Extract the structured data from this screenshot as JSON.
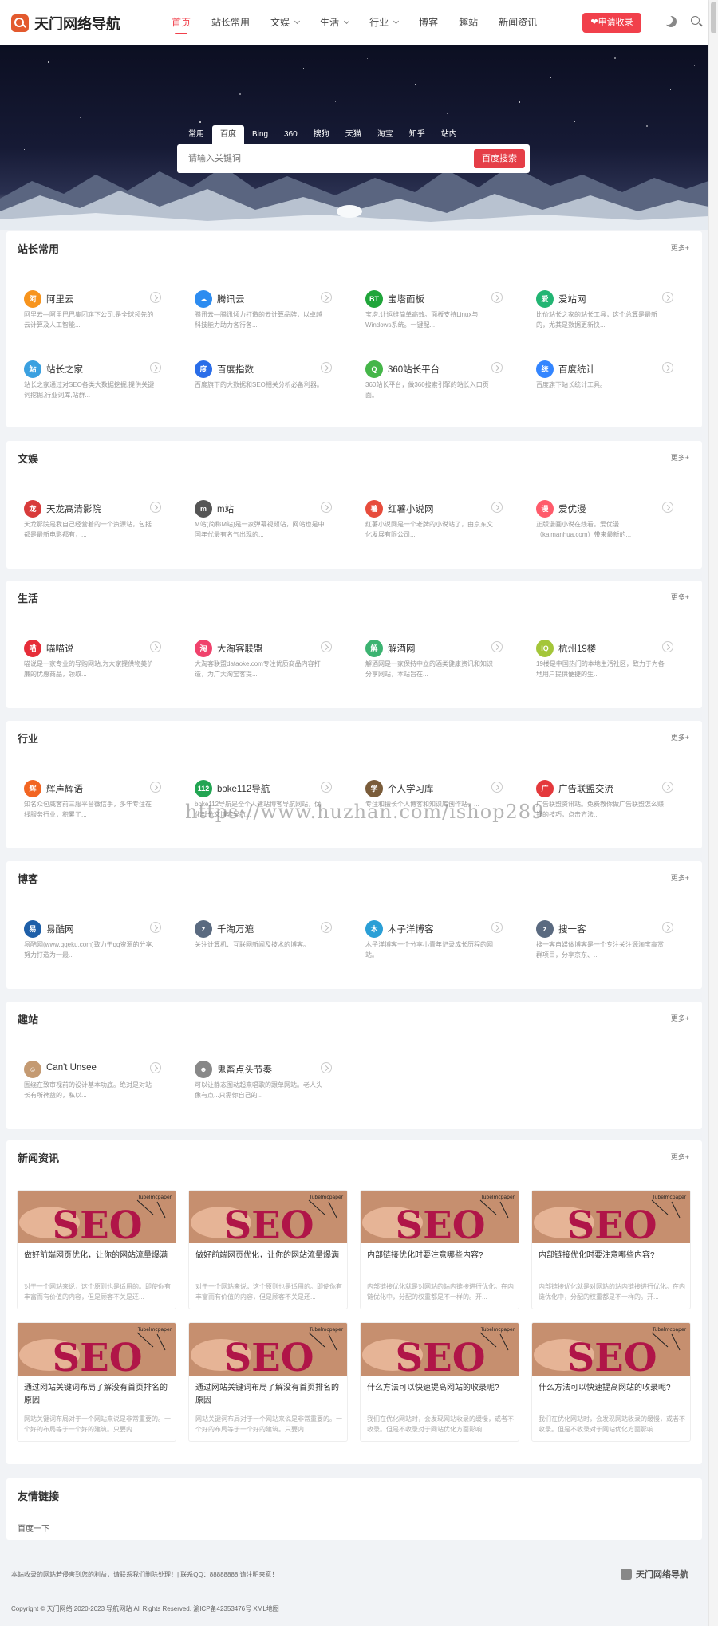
{
  "header": {
    "logo_text": "天门网络导航",
    "nav": [
      {
        "label": "首页",
        "active": true,
        "dropdown": false
      },
      {
        "label": "站长常用",
        "active": false,
        "dropdown": false
      },
      {
        "label": "文娱",
        "active": false,
        "dropdown": true
      },
      {
        "label": "生活",
        "active": false,
        "dropdown": true
      },
      {
        "label": "行业",
        "active": false,
        "dropdown": true
      },
      {
        "label": "博客",
        "active": false,
        "dropdown": false
      },
      {
        "label": "趣站",
        "active": false,
        "dropdown": false
      },
      {
        "label": "新闻资讯",
        "active": false,
        "dropdown": false
      }
    ],
    "apply_button": "❤申请收录",
    "icons": [
      "moon-icon",
      "search-icon"
    ]
  },
  "search": {
    "tabs": [
      "常用",
      "百度",
      "Bing",
      "360",
      "搜狗",
      "天猫",
      "淘宝",
      "知乎",
      "站内"
    ],
    "active_tab": "百度",
    "placeholder": "请输入关键词",
    "button": "百度搜索"
  },
  "more_label": "更多+",
  "sections": [
    {
      "title": "站长常用",
      "sites": [
        {
          "name": "阿里云",
          "desc": "阿里云—阿里巴巴集团旗下公司,是全球领先的云计算及人工智能...",
          "icon_color": "#f7941d",
          "icon_glyph": "阿"
        },
        {
          "name": "腾讯云",
          "desc": "腾讯云—腾讯倾力打造的云计算品牌，以卓越科技能力助力各行各...",
          "icon_color": "#2d8cf0",
          "icon_glyph": "☁"
        },
        {
          "name": "宝塔面板",
          "desc": "宝塔,让运维简单高效。面板支持Linux与Windows系统。一键配...",
          "icon_color": "#20a53a",
          "icon_glyph": "BT"
        },
        {
          "name": "爱站网",
          "desc": "比价站长之家的站长工具，这个总算是最新的，尤其是数据更新快...",
          "icon_color": "#22b573",
          "icon_glyph": "爱"
        },
        {
          "name": "站长之家",
          "desc": "站长之家通过对SEO各类大数据挖掘,提供关键词挖掘,行业词库,站群...",
          "icon_color": "#3aa0e0",
          "icon_glyph": "站"
        },
        {
          "name": "百度指数",
          "desc": "百度旗下的大数据和SEO相关分析必备利器。",
          "icon_color": "#2a6de8",
          "icon_glyph": "度"
        },
        {
          "name": "360站长平台",
          "desc": "360站长平台，做360搜索引擎的站长入口页面。",
          "icon_color": "#45b649",
          "icon_glyph": "Q"
        },
        {
          "name": "百度统计",
          "desc": "百度旗下站长统计工具。",
          "icon_color": "#3385ff",
          "icon_glyph": "统"
        }
      ]
    },
    {
      "title": "文娱",
      "sites": [
        {
          "name": "天龙高清影院",
          "desc": "天龙影院是我自己经营着的一个资源站，包括都是最新电影都有，...",
          "icon_color": "#d83b3b",
          "icon_glyph": "龙"
        },
        {
          "name": "m站",
          "desc": "M站(简称M站)是一家弹幕视频站，网站也是中国年代最有名气出现的...",
          "icon_color": "#555555",
          "icon_glyph": "m"
        },
        {
          "name": "红薯小说网",
          "desc": "红薯小说网是一个老牌的小说站了，由京东文化发展有限公司...",
          "icon_color": "#e74c3c",
          "icon_glyph": "薯"
        },
        {
          "name": "爱优漫",
          "desc": "正版漫画小说在线看。爱优漫（kaimanhua.com）带来最新的...",
          "icon_color": "#ff5b6b",
          "icon_glyph": "漫"
        }
      ]
    },
    {
      "title": "生活",
      "sites": [
        {
          "name": "喵喵说",
          "desc": "喵说是一家专业的导购网站,为大家提供物美价廉的优惠商品，领取...",
          "icon_color": "#e62d39",
          "icon_glyph": "喵"
        },
        {
          "name": "大淘客联盟",
          "desc": "大淘客联盟dataoke.com专注优质商品内容打造，为广大淘宝客提...",
          "icon_color": "#f0426c",
          "icon_glyph": "淘"
        },
        {
          "name": "解酒网",
          "desc": "解酒网是一家保持中立的酒类健康资讯和知识分享网站，本站旨在...",
          "icon_color": "#3cb371",
          "icon_glyph": "解"
        },
        {
          "name": "杭州19楼",
          "desc": "19楼是中国热门的本地生活社区，致力于为各地用户提供便捷的生...",
          "icon_color": "#a4c639",
          "icon_glyph": "IQ"
        }
      ]
    },
    {
      "title": "行业",
      "sites": [
        {
          "name": "辉声辉语",
          "desc": "知名众包威客前三服平台微信手，多年专注在线服务行业，积累了...",
          "icon_color": "#f26522",
          "icon_glyph": "辉"
        },
        {
          "name": "boke112导航",
          "desc": "boke112导航是全个人建站博客导航网站，优化部分文博客导航...",
          "icon_color": "#22a552",
          "icon_glyph": "112"
        },
        {
          "name": "个人学习库",
          "desc": "专注和擅长个人博客和知识库创作站，...",
          "icon_color": "#7a5c3a",
          "icon_glyph": "学"
        },
        {
          "name": "广告联盟交流",
          "desc": "广告联盟资讯站。免费教你做广告联盟怎么赚钱的技巧，点击方法...",
          "icon_color": "#e4393c",
          "icon_glyph": "广"
        }
      ]
    },
    {
      "title": "博客",
      "sites": [
        {
          "name": "易酷网",
          "desc": "易酷网(www.qqeku.com)致力于qq资源的分享,努力打造为一最...",
          "icon_color": "#1e5fa8",
          "icon_glyph": "易"
        },
        {
          "name": "千淘万漉",
          "desc": "关注计算机、互联网新闻及技术的博客。",
          "icon_color": "#5a6a80",
          "icon_glyph": "z"
        },
        {
          "name": "木子洋博客",
          "desc": "木子洋博客一个分享小青年记录成长历程的网站。",
          "icon_color": "#2a9fd6",
          "icon_glyph": "木"
        },
        {
          "name": "搜一客",
          "desc": "搜一客自媒体博客是一个专注关注源淘宝高赏群项目，分享京东、...",
          "icon_color": "#5a6a80",
          "icon_glyph": "z"
        }
      ]
    },
    {
      "title": "趣站",
      "sites": [
        {
          "name": "Can't Unsee",
          "desc": "围绕在致审视前的设计基本功底。绝对是对站长有所裨益的，私以...",
          "icon_color": "#c49a72",
          "icon_glyph": "☺"
        },
        {
          "name": "鬼畜点头节奏",
          "desc": "可以让静态图动起来唱歌的跟单网站。老人头像有点...只需你自己的...",
          "icon_color": "#888888",
          "icon_glyph": "☻"
        }
      ]
    }
  ],
  "news": {
    "title": "新闻资讯",
    "image_text": "SEO",
    "image_tag": "Tubelmcpaper",
    "items": [
      {
        "title": "做好前端网页优化，让你的网站流量爆满",
        "desc": "对于一个网站来说，这个原则也是适用的。即使你有丰富而有价值的内容，但是顾客不关是还..."
      },
      {
        "title": "做好前端网页优化，让你的网站流量爆满",
        "desc": "对于一个网站来说，这个原则也是适用的。即使你有丰富而有价值的内容，但是顾客不关是还..."
      },
      {
        "title": "内部链接优化时要注意哪些内容?",
        "desc": "内部链接优化就是对网站的站内链接进行优化。在内链优化中，分配的权重都是不一样的。开..."
      },
      {
        "title": "内部链接优化时要注意哪些内容?",
        "desc": "内部链接优化就是对网站的站内链接进行优化。在内链优化中，分配的权重都是不一样的。开..."
      },
      {
        "title": "通过网站关键词布局了解没有首页排名的原因",
        "desc": "网站关键词布局对于一个网站来说是非常重要的。一个好的布局等于一个好的建筑。只要内..."
      },
      {
        "title": "通过网站关键词布局了解没有首页排名的原因",
        "desc": "网站关键词布局对于一个网站来说是非常重要的。一个好的布局等于一个好的建筑。只要内..."
      },
      {
        "title": "什么方法可以快速提高网站的收录呢?",
        "desc": "我们在优化网站时，会发现网站收录的缓慢，或者不收录。但是不收录对于网站优化方面影响..."
      },
      {
        "title": "什么方法可以快速提高网站的收录呢?",
        "desc": "我们在优化网站时，会发现网站收录的缓慢，或者不收录。但是不收录对于网站优化方面影响..."
      }
    ]
  },
  "links": {
    "title": "友情链接",
    "items": [
      "百度一下"
    ]
  },
  "footer": {
    "notice": "本站收录的网站若侵害到您的利益，请联系我们删除处理！| 联系QQ：88888888 请注明来意！",
    "copyright": "Copyright © 天门网络 2020-2023 导航网站 All Rights Reserved. 渝ICP备42353476号 XML地图",
    "logo_text": "天门网络导航"
  },
  "watermark": "https://www.huzhan.com/ishop289"
}
